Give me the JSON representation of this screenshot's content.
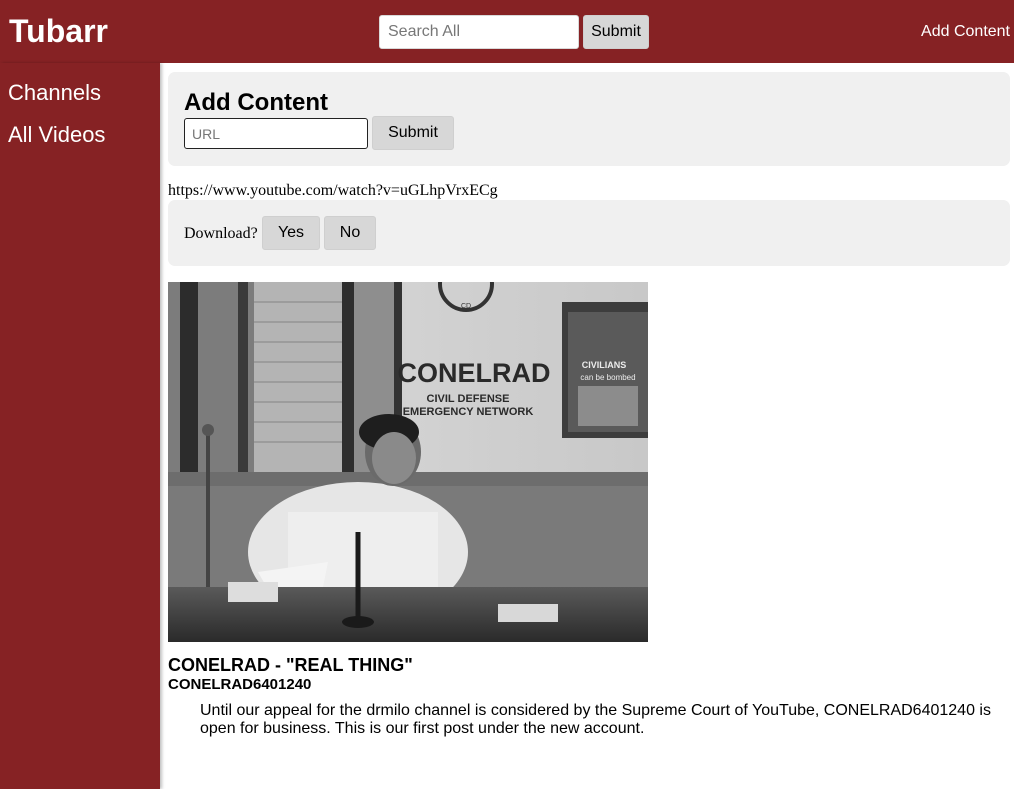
{
  "header": {
    "brand": "Tubarr",
    "search_placeholder": "Search All",
    "search_submit": "Submit",
    "add_content_link": "Add Content",
    "background": "#862224"
  },
  "sidebar": {
    "items": [
      {
        "label": "Channels"
      },
      {
        "label": "All Videos"
      }
    ]
  },
  "add_content": {
    "title": "Add Content",
    "url_placeholder": "URL",
    "submit_label": "Submit"
  },
  "lookup": {
    "video_url": "https://www.youtube.com/watch?v=uGLhpVrxECg",
    "download_prompt": "Download?",
    "yes_label": "Yes",
    "no_label": "No"
  },
  "video": {
    "thumbnail": {
      "sign_line1": "CONELRAD",
      "sign_line2": "CIVIL DEFENSE",
      "sign_line3": "EMERGENCY NETWORK",
      "poster_line1": "CIVILIANS",
      "poster_line2": "can be bombed"
    },
    "title": "CONELRAD - \"REAL THING\"",
    "channel": "CONELRAD6401240",
    "description": "Until our appeal for the drmilo channel is considered by the Supreme Court of YouTube, CONELRAD6401240 is open for business. This is our first post under the new account."
  }
}
